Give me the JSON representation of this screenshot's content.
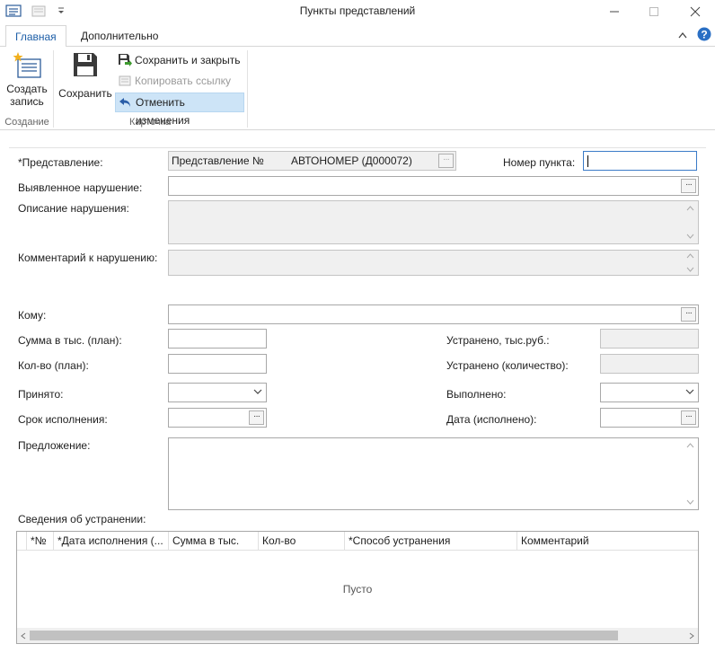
{
  "window": {
    "title": "Пункты представлений"
  },
  "ribbon": {
    "tabs": [
      {
        "label": "Главная",
        "active": true
      },
      {
        "label": "Дополнительно",
        "active": false
      }
    ],
    "groups": {
      "create": {
        "label": "Создание",
        "new_record_line1": "Создать",
        "new_record_line2": "запись"
      },
      "card": {
        "label": "Карточка",
        "save": "Сохранить",
        "save_close": "Сохранить и закрыть",
        "copy_link": "Копировать ссылку",
        "undo": "Отменить изменения"
      }
    }
  },
  "form": {
    "representation_label": "*Представление:",
    "representation_value_prefix": "Представление №",
    "representation_value_name": "АВТОНОМЕР (Д000072)",
    "item_number_label": "Номер пункта:",
    "item_number_value": "",
    "violation_label": "Выявленное нарушение:",
    "violation_value": "",
    "description_label": "Описание нарушения:",
    "comment_label": "Комментарий к нарушению:",
    "to_whom_label": "Кому:",
    "sum_plan_label": "Сумма в тыс. (план):",
    "qty_plan_label": "Кол-во (план):",
    "accepted_label": "Принято:",
    "deadline_label": "Срок исполнения:",
    "fixed_sum_label": "Устранено, тыс.руб.:",
    "fixed_qty_label": "Устранено (количество):",
    "done_label": "Выполнено:",
    "done_date_label": "Дата (исполнено):",
    "proposal_label": "Предложение:",
    "fix_info_label": "Сведения об устранении:"
  },
  "grid": {
    "columns": [
      "*№",
      "*Дата исполнения (...",
      "Сумма в тыс.",
      "Кол-во",
      "*Способ устранения",
      "Комментарий"
    ],
    "empty_text": "Пусто"
  },
  "icons": {
    "app": "app-window-icon",
    "qat": "quick-access-icon",
    "help": "help-icon"
  },
  "colors": {
    "accent": "#1e5fa8",
    "readonly_bg": "#f0f0f0",
    "hover": "#cde4f7"
  }
}
